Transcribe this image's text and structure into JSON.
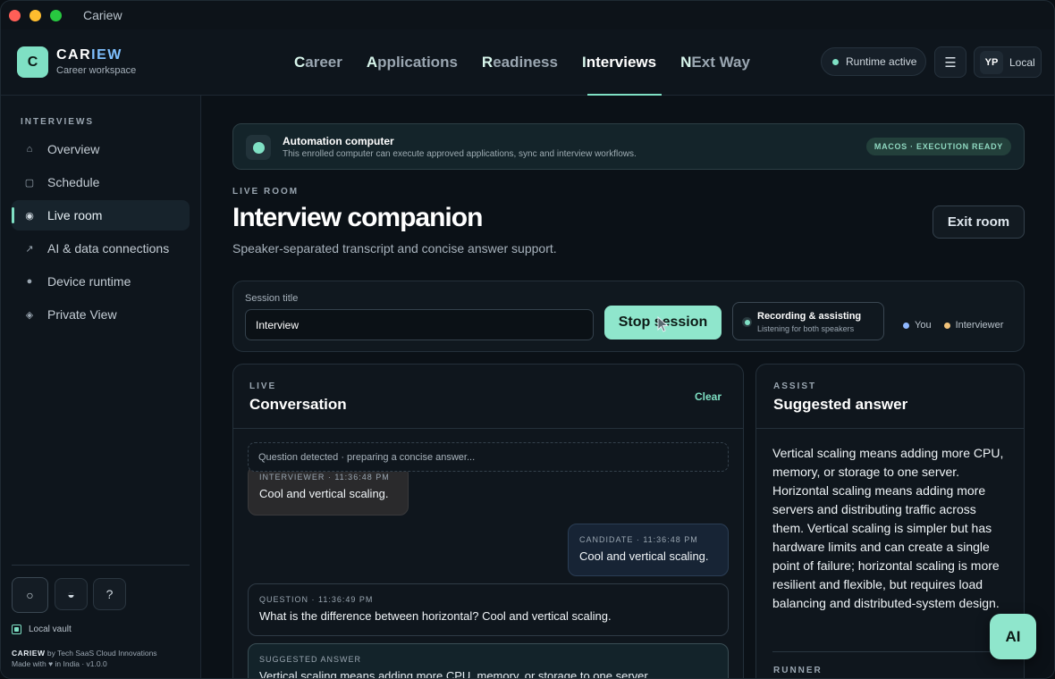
{
  "window": {
    "title": "Cariew"
  },
  "brand": {
    "logo_letter": "C",
    "name_a": "CAR",
    "name_b": "IEW",
    "subtitle": "Career workspace"
  },
  "nav": [
    {
      "first": "C",
      "rest": "areer",
      "active": false
    },
    {
      "first": "A",
      "rest": "pplications",
      "active": false
    },
    {
      "first": "R",
      "rest": "eadiness",
      "active": false
    },
    {
      "first": "I",
      "rest": "nterviews",
      "active": true
    },
    {
      "first": "N",
      "rest": "Ext Way",
      "active": false
    }
  ],
  "header": {
    "runtime_label": "Runtime active",
    "menu_icon": "hamburger-icon",
    "user_initials": "YP",
    "user_mode": "Local"
  },
  "sidebar": {
    "heading": "INTERVIEWS",
    "items": [
      {
        "label": "Overview",
        "icon": "home-icon",
        "glyph": "⌂"
      },
      {
        "label": "Schedule",
        "icon": "square-icon",
        "glyph": "▢"
      },
      {
        "label": "Live room",
        "icon": "radio-icon",
        "glyph": "◉"
      },
      {
        "label": "AI & data connections",
        "icon": "arrow-up-right-icon",
        "glyph": "↗"
      },
      {
        "label": "Device runtime",
        "icon": "circle-icon",
        "glyph": "●"
      },
      {
        "label": "Private View",
        "icon": "diamond-icon",
        "glyph": "◈"
      }
    ],
    "tools": {
      "circle": "○",
      "contrast": "◒",
      "help": "?"
    },
    "vault_label": "Local vault",
    "credit_brand": "CARIEW",
    "credit_line1": "by Tech SaaS Cloud Innovations",
    "credit_line2a": "Made with",
    "credit_line2b": "in India · v1.0.0"
  },
  "banner": {
    "title": "Automation computer",
    "subtitle": "This enrolled computer can execute approved applications, sync and interview workflows.",
    "badge": "MACOS · EXECUTION READY"
  },
  "page": {
    "eyebrow": "LIVE ROOM",
    "title": "Interview companion",
    "subtitle": "Speaker-separated transcript and concise answer support.",
    "exit_label": "Exit room"
  },
  "session": {
    "label": "Session title",
    "value": "Interview",
    "stop_label": "Stop session",
    "status_title": "Recording & assisting",
    "status_sub": "Listening for both speakers",
    "legend_you": "You",
    "legend_interviewer": "Interviewer"
  },
  "conversation": {
    "eyebrow": "LIVE",
    "title": "Conversation",
    "clear_label": "Clear",
    "detect_text": "Question detected · preparing a concise answer...",
    "messages": [
      {
        "meta": "INTERVIEWER · 11:36:48 PM",
        "text": "Cool and vertical scaling."
      },
      {
        "meta": "CANDIDATE · 11:36:48 PM",
        "text": "Cool and vertical scaling."
      },
      {
        "meta": "QUESTION · 11:36:49 PM",
        "text": "What is the difference between horizontal? Cool and vertical scaling."
      },
      {
        "meta": "SUGGESTED ANSWER",
        "text": "Vertical scaling means adding more CPU, memory, or storage to one server."
      }
    ]
  },
  "assist": {
    "eyebrow": "ASSIST",
    "title": "Suggested answer",
    "answer": "Vertical scaling means adding more CPU, memory, or storage to one server. Horizontal scaling means adding more servers and distributing traffic across them. Vertical scaling is simpler but has hardware limits and can create a single point of failure; horizontal scaling is more resilient and flexible, but requires load balancing and distributed-system design.",
    "runner_label": "RUNNER"
  },
  "fab": {
    "label": "AI"
  },
  "colors": {
    "accent": "#7fe0c4",
    "you": "#8fb8ff",
    "interviewer": "#f0c27a"
  }
}
